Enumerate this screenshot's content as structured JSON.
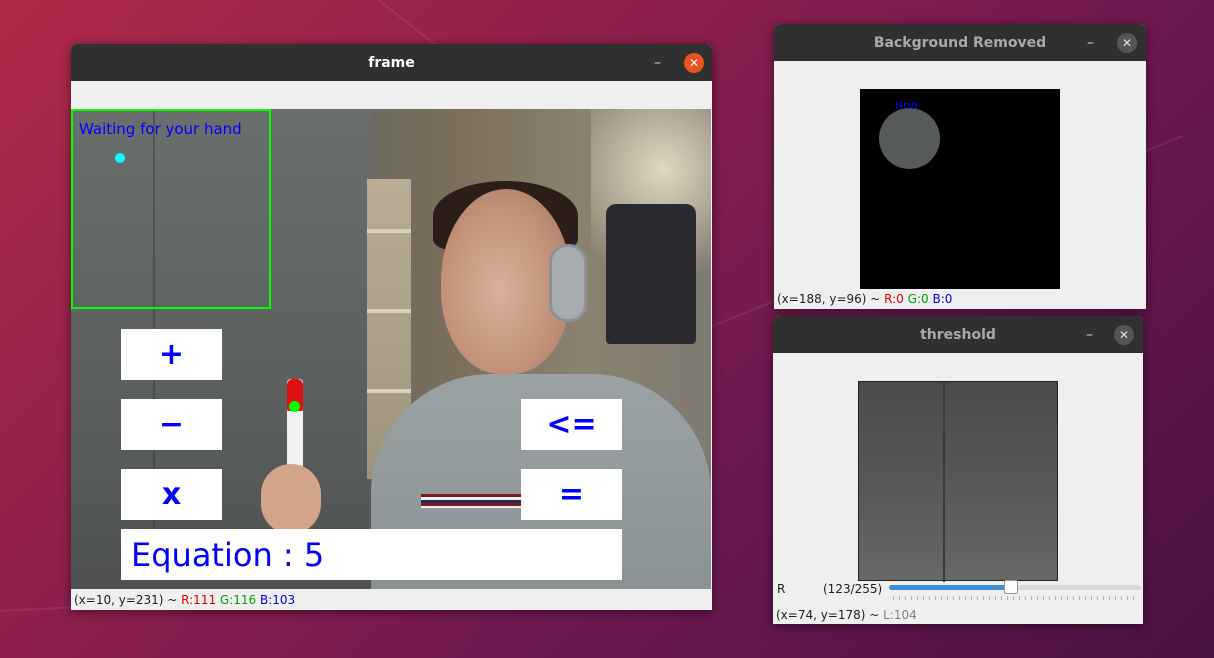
{
  "windows": {
    "frame": {
      "title": "frame",
      "roi_text": "Waiting for your hand",
      "operators": [
        "+",
        "−",
        "x",
        "<=",
        "="
      ],
      "equation": "Equation : 5",
      "status": {
        "coords": "(x=10, y=231) ~ ",
        "r": "R:111",
        "g": "G:116",
        "b": "B:103"
      }
    },
    "background_removed": {
      "title": "Background Removed",
      "status": {
        "coords": "(x=188, y=96) ~ ",
        "r": "R:0",
        "g": "G:0",
        "b": "B:0"
      }
    },
    "threshold": {
      "title": "threshold",
      "trackbar": {
        "label": "R",
        "value_text": "(123/255)",
        "value": 123,
        "max": 255
      },
      "status": {
        "coords": "(x=74, y=178) ~ ",
        "l": "L:104"
      }
    }
  },
  "icons": {
    "minimize": "–",
    "close": "✕"
  },
  "colors": {
    "roi": "#00ff00",
    "text_blue": "#0000ff",
    "close_active": "#e95420"
  }
}
